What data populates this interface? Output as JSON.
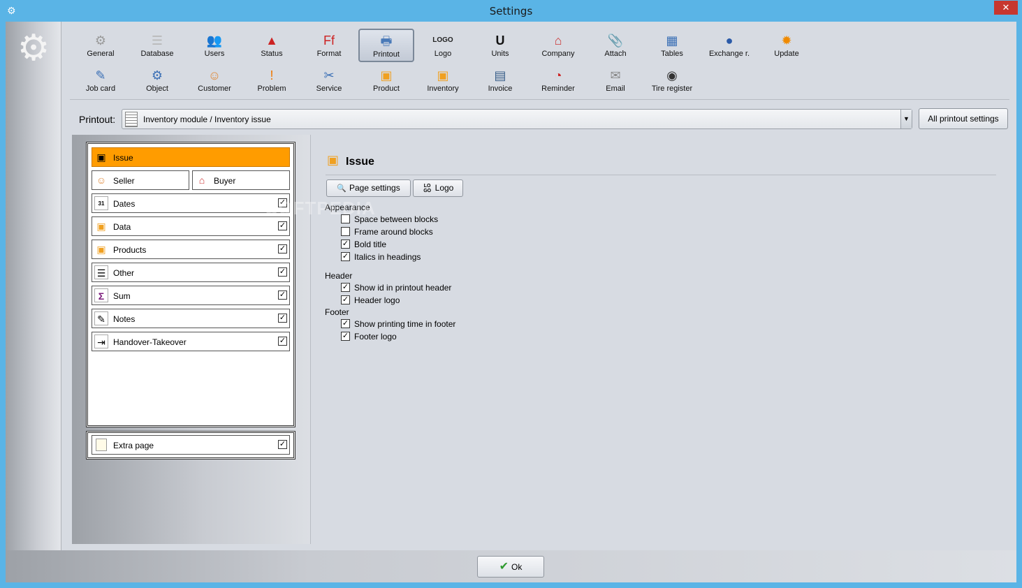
{
  "window": {
    "title": "Settings",
    "close_label": "✕"
  },
  "toolbar": {
    "row1": [
      {
        "name": "general",
        "label": "General",
        "icon": "⚙",
        "color": "#9a9a9a"
      },
      {
        "name": "database",
        "label": "Database",
        "icon": "☰",
        "color": "#b8b8b8"
      },
      {
        "name": "users",
        "label": "Users",
        "icon": "👥",
        "color": "#c96"
      },
      {
        "name": "status",
        "label": "Status",
        "icon": "▲",
        "color": "#c22"
      },
      {
        "name": "format",
        "label": "Format",
        "icon": "Ff",
        "color": "#c22"
      },
      {
        "name": "printout",
        "label": "Printout",
        "icon": "🖶",
        "color": "#4a7ab8",
        "active": true
      },
      {
        "name": "logo",
        "label": "Logo",
        "icon": "LOGO",
        "color": "#222"
      },
      {
        "name": "units",
        "label": "Units",
        "icon": "U",
        "color": "#111"
      },
      {
        "name": "company",
        "label": "Company",
        "icon": "⌂",
        "color": "#c33"
      },
      {
        "name": "attach",
        "label": "Attach",
        "icon": "📎",
        "color": "#888"
      },
      {
        "name": "tables",
        "label": "Tables",
        "icon": "▦",
        "color": "#3a6fb5"
      },
      {
        "name": "exchange",
        "label": "Exchange r.",
        "icon": "●",
        "color": "#2b5aa8"
      },
      {
        "name": "update",
        "label": "Update",
        "icon": "✹",
        "color": "#f08a00"
      }
    ],
    "row2": [
      {
        "name": "job-card",
        "label": "Job card",
        "icon": "✎",
        "color": "#3a6fb5"
      },
      {
        "name": "object",
        "label": "Object",
        "icon": "⚙",
        "color": "#3a6fb5"
      },
      {
        "name": "customer",
        "label": "Customer",
        "icon": "☺",
        "color": "#e08a3a"
      },
      {
        "name": "problem",
        "label": "Problem",
        "icon": "!",
        "color": "#f07800"
      },
      {
        "name": "service",
        "label": "Service",
        "icon": "✂",
        "color": "#3a6fb5"
      },
      {
        "name": "product",
        "label": "Product",
        "icon": "▣",
        "color": "#f0a020"
      },
      {
        "name": "inventory",
        "label": "Inventory",
        "icon": "▣",
        "color": "#f0a020"
      },
      {
        "name": "invoice",
        "label": "Invoice",
        "icon": "▤",
        "color": "#3a5f8a"
      },
      {
        "name": "reminder",
        "label": "Reminder",
        "icon": "◔",
        "color": "#c22"
      },
      {
        "name": "email",
        "label": "Email",
        "icon": "✉",
        "color": "#888"
      },
      {
        "name": "tire-register",
        "label": "Tire register",
        "icon": "◉",
        "color": "#333"
      }
    ]
  },
  "printout": {
    "label": "Printout:",
    "selected": "Inventory module / Inventory issue",
    "all_button": "All printout settings"
  },
  "blocks": {
    "issue": {
      "label": "Issue",
      "icon": "▣"
    },
    "seller": {
      "label": "Seller",
      "icon": "☺"
    },
    "buyer": {
      "label": "Buyer",
      "icon": "⌂"
    },
    "items": [
      {
        "label": "Dates",
        "icon": "31",
        "checked": true
      },
      {
        "label": "Data",
        "icon": "▣",
        "checked": true
      },
      {
        "label": "Products",
        "icon": "▣",
        "checked": true
      },
      {
        "label": "Other",
        "icon": "☰",
        "checked": true
      },
      {
        "label": "Sum",
        "icon": "Σ",
        "checked": true
      },
      {
        "label": "Notes",
        "icon": "✎",
        "checked": true
      },
      {
        "label": "Handover-Takeover",
        "icon": "⇥",
        "checked": true
      }
    ],
    "extra_page": {
      "label": "Extra page",
      "checked": true
    }
  },
  "detail": {
    "title": "Issue",
    "page_settings_button": "Page settings",
    "logo_button": "Logo",
    "logo_button_icon": "LO GO",
    "appearance_label": "Appearance",
    "appearance": [
      {
        "label": "Space between blocks",
        "checked": false
      },
      {
        "label": "Frame around blocks",
        "checked": false
      },
      {
        "label": "Bold title",
        "checked": true
      },
      {
        "label": "Italics in headings",
        "checked": true
      }
    ],
    "header_label": "Header",
    "header": [
      {
        "label": "Show id in printout header",
        "checked": true
      },
      {
        "label": "Header logo",
        "checked": true
      }
    ],
    "footer_label": "Footer",
    "footer": [
      {
        "label": "Show printing time in footer",
        "checked": true
      },
      {
        "label": "Footer logo",
        "checked": true
      }
    ]
  },
  "footer_bar": {
    "ok_label": "Ok"
  },
  "watermark": "SOFTPEDIA"
}
